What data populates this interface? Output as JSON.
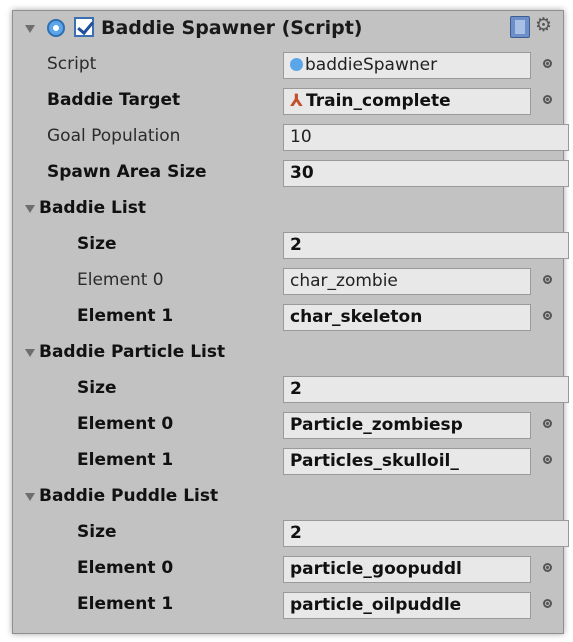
{
  "component": {
    "title": "Baddie Spawner (Script)",
    "enabled": true
  },
  "fields": {
    "script": {
      "label": "Script",
      "value": "baddieSpawner"
    },
    "baddie_target": {
      "label": "Baddie Target",
      "value": "Train_complete"
    },
    "goal_population": {
      "label": "Goal Population",
      "value": "10"
    },
    "spawn_area_size": {
      "label": "Spawn Area Size",
      "value": "30"
    }
  },
  "baddie_list": {
    "label": "Baddie List",
    "size_label": "Size",
    "size": "2",
    "elements": [
      {
        "label": "Element 0",
        "value": "char_zombie"
      },
      {
        "label": "Element 1",
        "value": "char_skeleton"
      }
    ]
  },
  "particle_list": {
    "label": "Baddie Particle List",
    "size_label": "Size",
    "size": "2",
    "elements": [
      {
        "label": "Element 0",
        "value": "Particle_zombiesp"
      },
      {
        "label": "Element 1",
        "value": "Particles_skulloil_"
      }
    ]
  },
  "puddle_list": {
    "label": "Baddie Puddle List",
    "size_label": "Size",
    "size": "2",
    "elements": [
      {
        "label": "Element 0",
        "value": "particle_goopuddl"
      },
      {
        "label": "Element 1",
        "value": "particle_oilpuddle"
      }
    ]
  }
}
